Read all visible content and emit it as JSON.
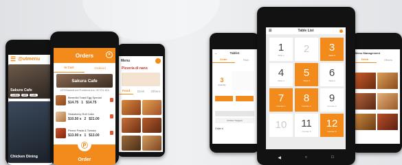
{
  "phone_left": {
    "brand": "@utmenu",
    "cards": [
      {
        "title": "Sakura Cafe",
        "tags": [
          "Coffee",
          "Wifi",
          "Cafe"
        ]
      },
      {
        "title": "Chicken Dining",
        "tags": []
      }
    ]
  },
  "orders_phone": {
    "title": "Orders",
    "tabs": [
      "In Cart",
      "Ordered"
    ],
    "restaurant": "Sakura Cafe",
    "address": "1379 Elizabeth Ave Providence Ave, OE 9711 AEA",
    "items": [
      {
        "name": "Benedict Toast Egg Special",
        "price": "$14.75",
        "qty": "1",
        "total": "$14.75"
      },
      {
        "name": "Strawberry Roll Cake",
        "price": "$10.50 x",
        "qty": "2",
        "total": "$21.00"
      },
      {
        "name": "Penne Pasta & Tomato",
        "price": "$13.00 x",
        "qty": "1",
        "total": "$13.00"
      }
    ],
    "order_label": "Order",
    "order_icon": "p-logo-icon"
  },
  "menu_phone": {
    "title": "Menu",
    "restaurant": "Pizzeria di nano",
    "tabs": [
      "Food",
      "Drink",
      "Others"
    ]
  },
  "tablet_left": {
    "title": "Table1",
    "tabs": [
      "Order",
      "Paid"
    ],
    "qty_value": "3",
    "qty_label": "Quantity",
    "label": "Order #",
    "sub_label": "Chicken Nuggets"
  },
  "tablet_center": {
    "title": "Table List",
    "tables": [
      {
        "num": "1",
        "label": "Table 1",
        "state": "free"
      },
      {
        "num": "2",
        "label": "",
        "state": "disabled"
      },
      {
        "num": "3",
        "label": "Table 3",
        "state": "busy"
      },
      {
        "num": "4",
        "label": "Table 4",
        "state": "free"
      },
      {
        "num": "5",
        "label": "Table 5",
        "state": "busy"
      },
      {
        "num": "6",
        "label": "Table 6",
        "state": "free"
      },
      {
        "num": "7",
        "label": "Counter 1",
        "state": "busy"
      },
      {
        "num": "8",
        "label": "Counter 2",
        "state": "busy"
      },
      {
        "num": "9",
        "label": "Counter 3",
        "state": "free"
      },
      {
        "num": "10",
        "label": "",
        "state": "disabled"
      },
      {
        "num": "11",
        "label": "Counter 5",
        "state": "free"
      },
      {
        "num": "12",
        "label": "Counter 6",
        "state": "busy"
      }
    ]
  },
  "tablet_right": {
    "title": "Menu Management",
    "tabs": [
      "Drink",
      "Others"
    ]
  },
  "colors": {
    "accent": "#f28a1c"
  }
}
